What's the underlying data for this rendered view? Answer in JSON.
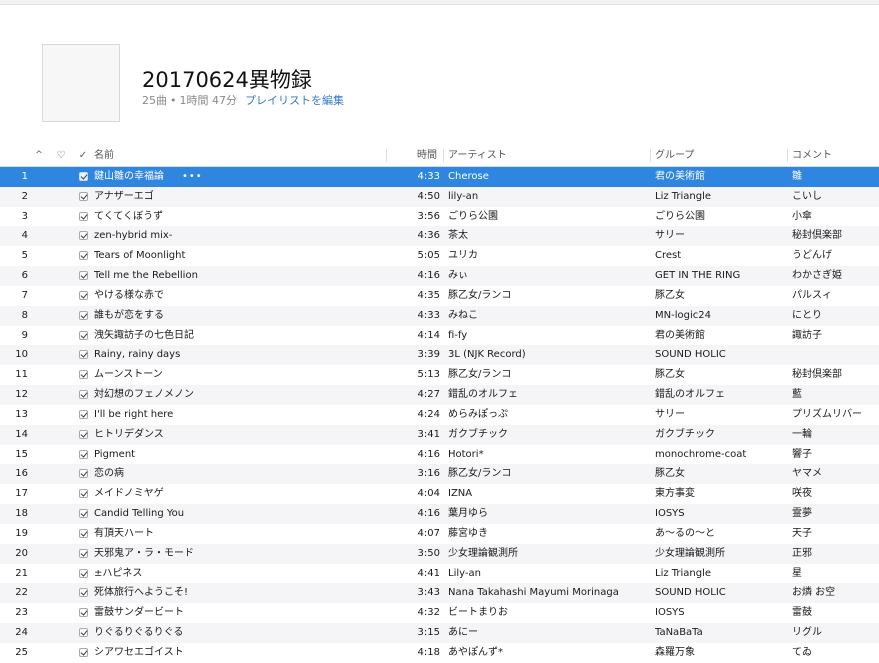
{
  "playlist": {
    "title": "20170624異物録",
    "count": "25曲",
    "separator": "•",
    "duration": "1時間 47分",
    "edit_label": "プレイリストを編集"
  },
  "columns": {
    "sort_indicator": "^",
    "heart": "♡",
    "check": "✓",
    "name": "名前",
    "time": "時間",
    "artist": "アーティスト",
    "group": "グループ",
    "comment": "コメント"
  },
  "selected_more": "•••",
  "colors": {
    "selection": "#2f86e1",
    "edit_link": "#3478c6",
    "alt_row": "#f5f5f7"
  },
  "tracks": [
    {
      "num": "1",
      "name": "鍵山雛の幸福論",
      "time": "4:33",
      "artist": "Cherose",
      "group": "君の美術館",
      "comment": "雛"
    },
    {
      "num": "2",
      "name": "アナザーエゴ",
      "time": "4:50",
      "artist": "lily-an",
      "group": "Liz Triangle",
      "comment": "こいし"
    },
    {
      "num": "3",
      "name": "てくてくぼうず",
      "time": "3:56",
      "artist": "ごりら公園",
      "group": "ごりら公園",
      "comment": "小傘"
    },
    {
      "num": "4",
      "name": "zen-hybrid mix-",
      "time": "4:36",
      "artist": "茶太",
      "group": "サリー",
      "comment": "秘封倶楽部"
    },
    {
      "num": "5",
      "name": "Tears of Moonlight",
      "time": "5:05",
      "artist": "ユリカ",
      "group": "Crest",
      "comment": "うどんげ"
    },
    {
      "num": "6",
      "name": "Tell me the Rebellion",
      "time": "4:16",
      "artist": "みぃ",
      "group": "GET IN THE RING",
      "comment": "わかさぎ姫"
    },
    {
      "num": "7",
      "name": "やける様な赤で",
      "time": "4:35",
      "artist": "豚乙女/ランコ",
      "group": "豚乙女",
      "comment": "パルスィ"
    },
    {
      "num": "8",
      "name": "誰もが恋をする",
      "time": "4:33",
      "artist": "みねこ",
      "group": "MN-logic24",
      "comment": "にとり"
    },
    {
      "num": "9",
      "name": "洩矢諏訪子の七色日記",
      "time": "4:14",
      "artist": "fi-fy",
      "group": "君の美術館",
      "comment": "諏訪子"
    },
    {
      "num": "10",
      "name": "Rainy, rainy days",
      "time": "3:39",
      "artist": "3L (NJK Record)",
      "group": "SOUND HOLIC",
      "comment": ""
    },
    {
      "num": "11",
      "name": "ムーンストーン",
      "time": "5:13",
      "artist": "豚乙女/ランコ",
      "group": "豚乙女",
      "comment": "秘封倶楽部"
    },
    {
      "num": "12",
      "name": "対幻想のフェノメノン",
      "time": "4:27",
      "artist": "錯乱のオルフェ",
      "group": "錯乱のオルフェ",
      "comment": "藍"
    },
    {
      "num": "13",
      "name": "I'll be right here",
      "time": "4:24",
      "artist": "めらみぽっぷ",
      "group": "サリー",
      "comment": "プリズムリバー"
    },
    {
      "num": "14",
      "name": "ヒトリデダンス",
      "time": "3:41",
      "artist": "ガクブチック",
      "group": "ガクブチック",
      "comment": "一輪"
    },
    {
      "num": "15",
      "name": "Pigment",
      "time": "4:16",
      "artist": "Hotori*",
      "group": "monochrome-coat",
      "comment": "響子"
    },
    {
      "num": "16",
      "name": "恋の病",
      "time": "3:16",
      "artist": "豚乙女/ランコ",
      "group": "豚乙女",
      "comment": "ヤマメ"
    },
    {
      "num": "17",
      "name": "メイドノミヤゲ",
      "time": "4:04",
      "artist": "IZNA",
      "group": "東方事変",
      "comment": "咲夜"
    },
    {
      "num": "18",
      "name": "Candid Telling You",
      "time": "4:16",
      "artist": "葉月ゆら",
      "group": "IOSYS",
      "comment": "霊夢"
    },
    {
      "num": "19",
      "name": "有頂天ハート",
      "time": "4:07",
      "artist": "藤宮ゆき",
      "group": "あ～るの～と",
      "comment": "天子"
    },
    {
      "num": "20",
      "name": "天邪鬼ア・ラ・モード",
      "time": "3:50",
      "artist": "少女理論観測所",
      "group": "少女理論観測所",
      "comment": "正邪"
    },
    {
      "num": "21",
      "name": "±ハピネス",
      "time": "4:41",
      "artist": "Lily-an",
      "group": "Liz Triangle",
      "comment": "星"
    },
    {
      "num": "22",
      "name": "死体旅行へようこそ!",
      "time": "3:43",
      "artist": "Nana Takahashi Mayumi Morinaga",
      "group": "SOUND HOLIC",
      "comment": "お燐 お空"
    },
    {
      "num": "23",
      "name": "雷鼓サンダービート",
      "time": "4:32",
      "artist": "ビートまりお",
      "group": "IOSYS",
      "comment": "雷鼓"
    },
    {
      "num": "24",
      "name": "りぐるりぐるりぐる",
      "time": "3:15",
      "artist": "あにー",
      "group": "TaNaBaTa",
      "comment": "リグル"
    },
    {
      "num": "25",
      "name": "シアワセエゴイスト",
      "time": "4:18",
      "artist": "あやぽんず*",
      "group": "森羅万象",
      "comment": "てゐ"
    }
  ]
}
